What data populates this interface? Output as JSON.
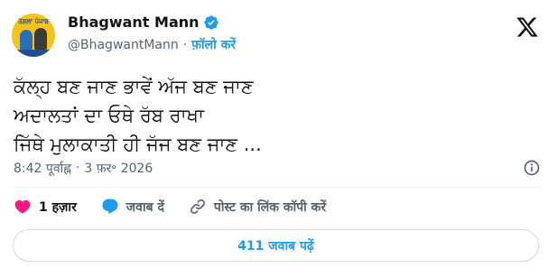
{
  "author": {
    "avatar_text": "ਰੰਗਲਾ ਪੰਜਾਬ",
    "display_name": "Bhagwant Mann",
    "handle": "@BhagwantMann",
    "separator": "·",
    "follow_label": "फ़ॉलो करें"
  },
  "tweet": {
    "lines": [
      "ਕੱਲ੍ਹ ਬਣ ਜਾਣ ਭਾਵੇਂ ਅੱਜ ਬਣ ਜਾਣ",
      "ਅਦਾਲਤਾਂ ਦਾ ਓਥੇ ਰੱਬ ਰਾਖਾ",
      "ਜਿੱਥੇ ਮੁਲਾਕਾਤੀ ਹੀ ਜੱਜ ਬਣ ਜਾਣ ..."
    ]
  },
  "meta": {
    "time": "8:42 पूर्वाह्न",
    "separator": "·",
    "date": "3 फ़र॰ 2026"
  },
  "actions": {
    "like_count": "1 हज़ार",
    "reply_label": "जवाब दें",
    "copy_label": "पोस्ट का लिंक कॉपी करें"
  },
  "read_replies_label": "411 जवाब पढ़ें",
  "colors": {
    "like": "#f91880",
    "link": "#1d9bf0",
    "verified": "#1d9bf0",
    "muted": "#536471"
  }
}
